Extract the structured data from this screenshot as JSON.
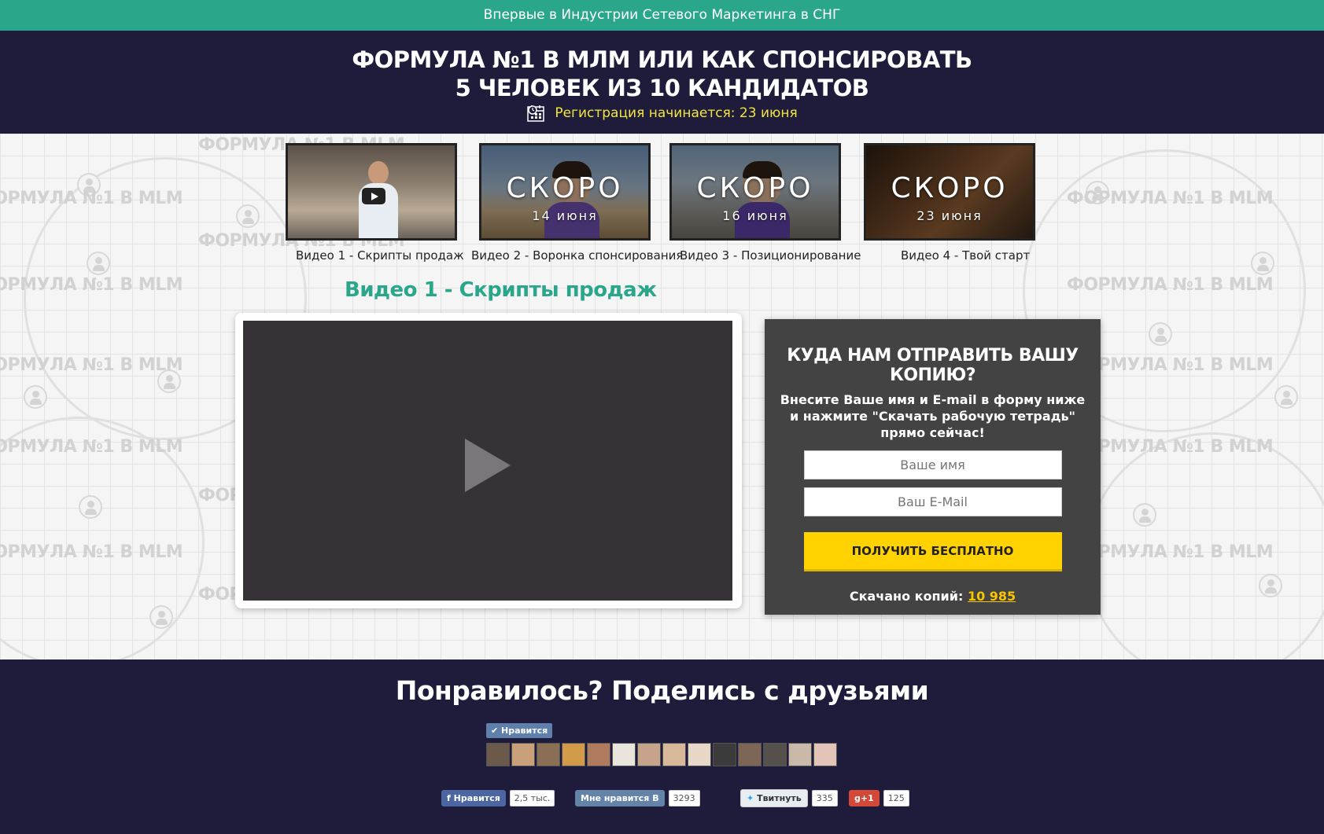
{
  "top_strip": {
    "text": "Впервые в Индустрии Сетевого Маркетинга в СНГ"
  },
  "header": {
    "title_line1": "ФОРМУЛА №1 В МЛМ ИЛИ КАК СПОНСИРОВАТЬ",
    "title_line2": "5 ЧЕЛОВЕК ИЗ 10 КАНДИДАТОВ",
    "registration": "Регистрация начинается: 23 июня"
  },
  "watermark": {
    "text": "ФОРМУЛА №1 В MLM"
  },
  "videos": [
    {
      "label": "Видео 1 - Скрипты продаж"
    },
    {
      "label": "Видео 2 - Воронка спонсирования",
      "soon": "СКОРО",
      "date": "14 июня"
    },
    {
      "label": "Видео 3 - Позиционирование",
      "soon": "СКОРО",
      "date": "16 июня"
    },
    {
      "label": "Видео 4 - Твой старт",
      "soon": "СКОРО",
      "date": "23 июня"
    }
  ],
  "current_video": {
    "title": "Видео 1 - Скрипты продаж"
  },
  "form": {
    "heading": "КУДА НАМ ОТПРАВИТЬ ВАШУ КОПИЮ?",
    "desc_line1": "Внесите Ваше имя и E-mail в форму ниже",
    "desc_line2": "и нажмите \"Скачать рабочую тетрадь\"",
    "desc_line3": "прямо сейчас!",
    "name_placeholder": "Ваше имя",
    "email_placeholder": "Ваш E-Mail",
    "submit_label": "ПОЛУЧИТЬ БЕСПЛАТНО",
    "count_label": "Скачано копий:",
    "count_value": "10 985"
  },
  "footer": {
    "share_title": "Понравилось? Поделись с друзьями",
    "vk_like_label": "Нравится",
    "fb": {
      "label": "Нравится",
      "count": "2,5 тыс."
    },
    "vk": {
      "label": "Мне нравится",
      "count": "3293"
    },
    "tw": {
      "label": "Твитнуть",
      "count": "335"
    },
    "gp": {
      "label": "+1",
      "count": "125"
    }
  },
  "colors": {
    "accent": "#2aa78a",
    "dark": "#1e1c3a",
    "yellow": "#ffd200",
    "panel": "#434343"
  }
}
